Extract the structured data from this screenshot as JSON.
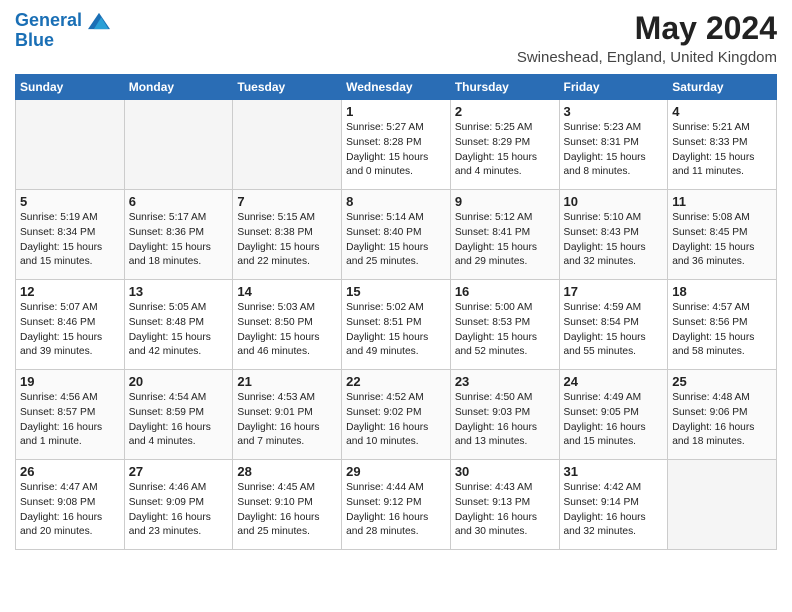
{
  "header": {
    "logo_line1": "General",
    "logo_line2": "Blue",
    "month_title": "May 2024",
    "location": "Swineshead, England, United Kingdom"
  },
  "weekdays": [
    "Sunday",
    "Monday",
    "Tuesday",
    "Wednesday",
    "Thursday",
    "Friday",
    "Saturday"
  ],
  "weeks": [
    [
      {
        "day": "",
        "empty": true
      },
      {
        "day": "",
        "empty": true
      },
      {
        "day": "",
        "empty": true
      },
      {
        "day": "1",
        "sunrise": "Sunrise: 5:27 AM",
        "sunset": "Sunset: 8:28 PM",
        "daylight": "Daylight: 15 hours and 0 minutes."
      },
      {
        "day": "2",
        "sunrise": "Sunrise: 5:25 AM",
        "sunset": "Sunset: 8:29 PM",
        "daylight": "Daylight: 15 hours and 4 minutes."
      },
      {
        "day": "3",
        "sunrise": "Sunrise: 5:23 AM",
        "sunset": "Sunset: 8:31 PM",
        "daylight": "Daylight: 15 hours and 8 minutes."
      },
      {
        "day": "4",
        "sunrise": "Sunrise: 5:21 AM",
        "sunset": "Sunset: 8:33 PM",
        "daylight": "Daylight: 15 hours and 11 minutes."
      }
    ],
    [
      {
        "day": "5",
        "sunrise": "Sunrise: 5:19 AM",
        "sunset": "Sunset: 8:34 PM",
        "daylight": "Daylight: 15 hours and 15 minutes."
      },
      {
        "day": "6",
        "sunrise": "Sunrise: 5:17 AM",
        "sunset": "Sunset: 8:36 PM",
        "daylight": "Daylight: 15 hours and 18 minutes."
      },
      {
        "day": "7",
        "sunrise": "Sunrise: 5:15 AM",
        "sunset": "Sunset: 8:38 PM",
        "daylight": "Daylight: 15 hours and 22 minutes."
      },
      {
        "day": "8",
        "sunrise": "Sunrise: 5:14 AM",
        "sunset": "Sunset: 8:40 PM",
        "daylight": "Daylight: 15 hours and 25 minutes."
      },
      {
        "day": "9",
        "sunrise": "Sunrise: 5:12 AM",
        "sunset": "Sunset: 8:41 PM",
        "daylight": "Daylight: 15 hours and 29 minutes."
      },
      {
        "day": "10",
        "sunrise": "Sunrise: 5:10 AM",
        "sunset": "Sunset: 8:43 PM",
        "daylight": "Daylight: 15 hours and 32 minutes."
      },
      {
        "day": "11",
        "sunrise": "Sunrise: 5:08 AM",
        "sunset": "Sunset: 8:45 PM",
        "daylight": "Daylight: 15 hours and 36 minutes."
      }
    ],
    [
      {
        "day": "12",
        "sunrise": "Sunrise: 5:07 AM",
        "sunset": "Sunset: 8:46 PM",
        "daylight": "Daylight: 15 hours and 39 minutes."
      },
      {
        "day": "13",
        "sunrise": "Sunrise: 5:05 AM",
        "sunset": "Sunset: 8:48 PM",
        "daylight": "Daylight: 15 hours and 42 minutes."
      },
      {
        "day": "14",
        "sunrise": "Sunrise: 5:03 AM",
        "sunset": "Sunset: 8:50 PM",
        "daylight": "Daylight: 15 hours and 46 minutes."
      },
      {
        "day": "15",
        "sunrise": "Sunrise: 5:02 AM",
        "sunset": "Sunset: 8:51 PM",
        "daylight": "Daylight: 15 hours and 49 minutes."
      },
      {
        "day": "16",
        "sunrise": "Sunrise: 5:00 AM",
        "sunset": "Sunset: 8:53 PM",
        "daylight": "Daylight: 15 hours and 52 minutes."
      },
      {
        "day": "17",
        "sunrise": "Sunrise: 4:59 AM",
        "sunset": "Sunset: 8:54 PM",
        "daylight": "Daylight: 15 hours and 55 minutes."
      },
      {
        "day": "18",
        "sunrise": "Sunrise: 4:57 AM",
        "sunset": "Sunset: 8:56 PM",
        "daylight": "Daylight: 15 hours and 58 minutes."
      }
    ],
    [
      {
        "day": "19",
        "sunrise": "Sunrise: 4:56 AM",
        "sunset": "Sunset: 8:57 PM",
        "daylight": "Daylight: 16 hours and 1 minute."
      },
      {
        "day": "20",
        "sunrise": "Sunrise: 4:54 AM",
        "sunset": "Sunset: 8:59 PM",
        "daylight": "Daylight: 16 hours and 4 minutes."
      },
      {
        "day": "21",
        "sunrise": "Sunrise: 4:53 AM",
        "sunset": "Sunset: 9:01 PM",
        "daylight": "Daylight: 16 hours and 7 minutes."
      },
      {
        "day": "22",
        "sunrise": "Sunrise: 4:52 AM",
        "sunset": "Sunset: 9:02 PM",
        "daylight": "Daylight: 16 hours and 10 minutes."
      },
      {
        "day": "23",
        "sunrise": "Sunrise: 4:50 AM",
        "sunset": "Sunset: 9:03 PM",
        "daylight": "Daylight: 16 hours and 13 minutes."
      },
      {
        "day": "24",
        "sunrise": "Sunrise: 4:49 AM",
        "sunset": "Sunset: 9:05 PM",
        "daylight": "Daylight: 16 hours and 15 minutes."
      },
      {
        "day": "25",
        "sunrise": "Sunrise: 4:48 AM",
        "sunset": "Sunset: 9:06 PM",
        "daylight": "Daylight: 16 hours and 18 minutes."
      }
    ],
    [
      {
        "day": "26",
        "sunrise": "Sunrise: 4:47 AM",
        "sunset": "Sunset: 9:08 PM",
        "daylight": "Daylight: 16 hours and 20 minutes."
      },
      {
        "day": "27",
        "sunrise": "Sunrise: 4:46 AM",
        "sunset": "Sunset: 9:09 PM",
        "daylight": "Daylight: 16 hours and 23 minutes."
      },
      {
        "day": "28",
        "sunrise": "Sunrise: 4:45 AM",
        "sunset": "Sunset: 9:10 PM",
        "daylight": "Daylight: 16 hours and 25 minutes."
      },
      {
        "day": "29",
        "sunrise": "Sunrise: 4:44 AM",
        "sunset": "Sunset: 9:12 PM",
        "daylight": "Daylight: 16 hours and 28 minutes."
      },
      {
        "day": "30",
        "sunrise": "Sunrise: 4:43 AM",
        "sunset": "Sunset: 9:13 PM",
        "daylight": "Daylight: 16 hours and 30 minutes."
      },
      {
        "day": "31",
        "sunrise": "Sunrise: 4:42 AM",
        "sunset": "Sunset: 9:14 PM",
        "daylight": "Daylight: 16 hours and 32 minutes."
      },
      {
        "day": "",
        "empty": true
      }
    ]
  ]
}
